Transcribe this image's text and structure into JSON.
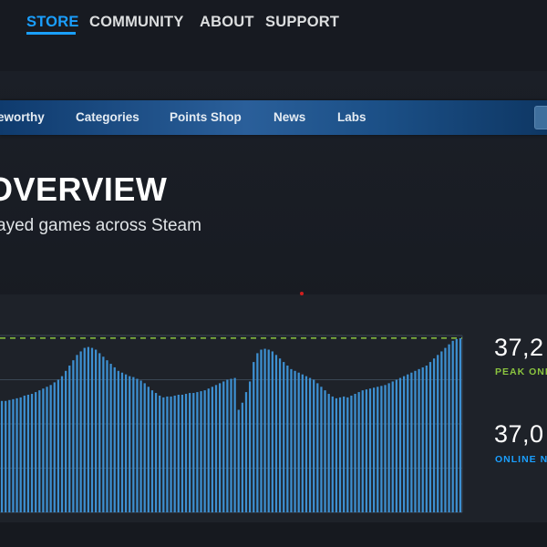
{
  "global_nav": {
    "items": [
      {
        "label": "STORE",
        "active": true
      },
      {
        "label": "COMMUNITY",
        "active": false
      },
      {
        "label": "ABOUT",
        "active": false
      },
      {
        "label": "SUPPORT",
        "active": false
      }
    ]
  },
  "store_nav": {
    "items": [
      {
        "label": "eworthy"
      },
      {
        "label": "Categories"
      },
      {
        "label": "Points Shop"
      },
      {
        "label": "News"
      },
      {
        "label": "Labs"
      }
    ]
  },
  "header": {
    "title": "OVERVIEW",
    "subtitle": "ayed games across Steam"
  },
  "stats": {
    "peak_value": "37,2",
    "peak_label": "PEAK ONL",
    "online_value": "37,0",
    "online_label": "ONLINE N"
  },
  "colors": {
    "accent": "#1a9fff",
    "peak_green": "#8bc53f",
    "bar_blue": "#3d8fd0",
    "grid": "#3a4654"
  },
  "chart_data": {
    "type": "bar",
    "ylim": [
      0,
      1
    ],
    "peak_line": 0.985,
    "values": [
      0.63,
      0.63,
      0.635,
      0.64,
      0.645,
      0.65,
      0.66,
      0.665,
      0.67,
      0.68,
      0.69,
      0.7,
      0.71,
      0.72,
      0.735,
      0.75,
      0.77,
      0.8,
      0.83,
      0.86,
      0.89,
      0.91,
      0.93,
      0.935,
      0.93,
      0.92,
      0.9,
      0.88,
      0.86,
      0.84,
      0.82,
      0.8,
      0.79,
      0.78,
      0.77,
      0.765,
      0.755,
      0.745,
      0.73,
      0.71,
      0.69,
      0.675,
      0.66,
      0.65,
      0.655,
      0.655,
      0.66,
      0.665,
      0.665,
      0.67,
      0.675,
      0.675,
      0.68,
      0.685,
      0.69,
      0.7,
      0.71,
      0.72,
      0.73,
      0.74,
      0.75,
      0.755,
      0.76,
      0.58,
      0.62,
      0.68,
      0.74,
      0.85,
      0.9,
      0.92,
      0.925,
      0.92,
      0.91,
      0.89,
      0.87,
      0.85,
      0.83,
      0.81,
      0.8,
      0.79,
      0.78,
      0.77,
      0.76,
      0.75,
      0.73,
      0.71,
      0.69,
      0.67,
      0.655,
      0.645,
      0.65,
      0.655,
      0.65,
      0.66,
      0.67,
      0.68,
      0.69,
      0.695,
      0.7,
      0.705,
      0.71,
      0.715,
      0.72,
      0.73,
      0.74,
      0.75,
      0.76,
      0.77,
      0.78,
      0.79,
      0.8,
      0.81,
      0.82,
      0.83,
      0.85,
      0.87,
      0.89,
      0.91,
      0.93,
      0.95,
      0.97,
      0.98,
      0.985
    ]
  }
}
